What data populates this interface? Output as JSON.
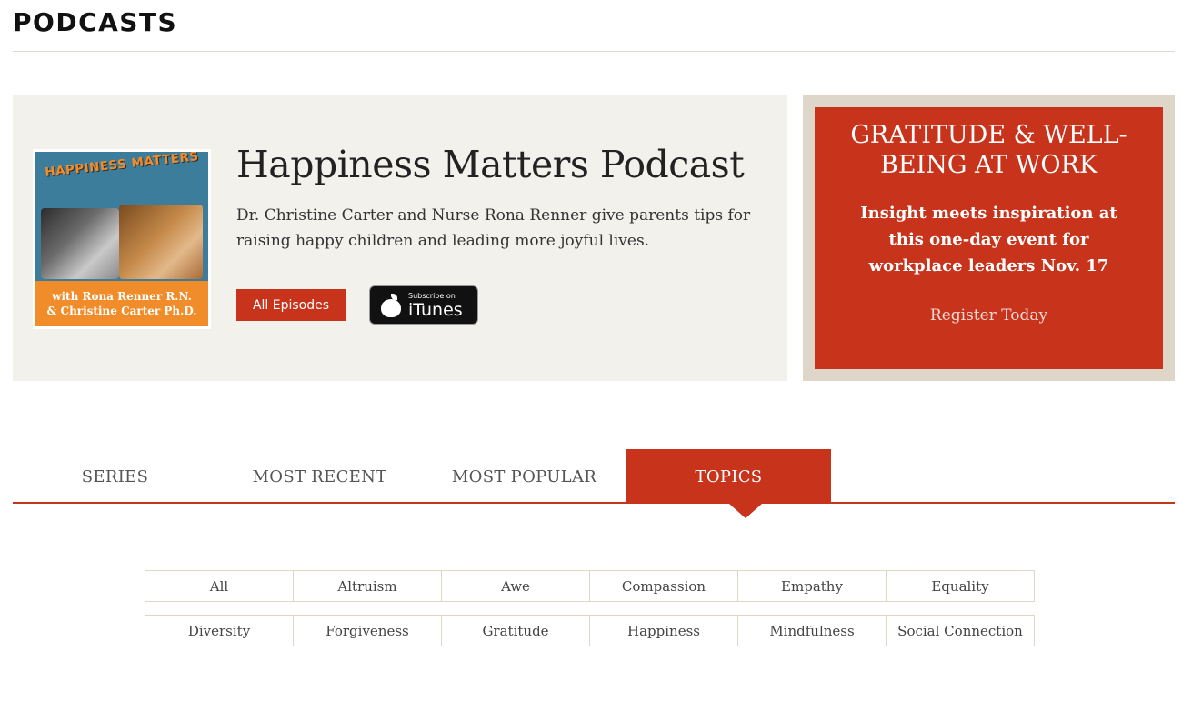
{
  "page": {
    "heading": "PODCASTS"
  },
  "podcast": {
    "cover": {
      "title": "HAPPINESS MATTERS",
      "credit_line1": "with Rona Renner R.N.",
      "credit_line2": "& Christine Carter Ph.D."
    },
    "title": "Happiness Matters Podcast",
    "description": "Dr. Christine Carter and Nurse Rona Renner give parents tips for raising happy children and leading more joyful lives.",
    "all_episodes_label": "All Episodes",
    "itunes": {
      "small": "Subscribe on",
      "big": "iTunes",
      "icon": "apple-icon"
    }
  },
  "event": {
    "title": "GRATITUDE & WELL-BEING AT WORK",
    "subtitle": "Insight meets inspiration at this one-day event for workplace leaders Nov. 17",
    "cta": "Register Today"
  },
  "tabs": [
    {
      "label": "SERIES",
      "active": false
    },
    {
      "label": "MOST RECENT",
      "active": false
    },
    {
      "label": "MOST POPULAR",
      "active": false
    },
    {
      "label": "TOPICS",
      "active": true
    }
  ],
  "topics": [
    [
      "All",
      "Altruism",
      "Awe",
      "Compassion",
      "Empathy",
      "Equality"
    ],
    [
      "Diversity",
      "Forgiveness",
      "Gratitude",
      "Happiness",
      "Mindfulness",
      "Social Connection"
    ]
  ],
  "colors": {
    "accent": "#c8331c",
    "card_bg": "#f3f1ec",
    "promo_frame": "#ddd6c9",
    "cover_orange": "#f08c2a",
    "cover_blue": "#3d7d9c"
  }
}
